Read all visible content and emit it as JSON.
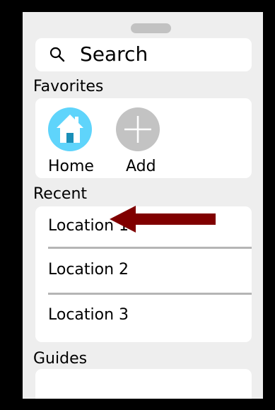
{
  "search": {
    "label": "Search",
    "icon": "search-icon"
  },
  "favorites": {
    "heading": "Favorites",
    "items": [
      {
        "label": "Home",
        "icon": "home-icon",
        "color": "#5fd4fb"
      },
      {
        "label": "Add",
        "icon": "plus-icon",
        "color": "#c3c3c3"
      }
    ]
  },
  "recent": {
    "heading": "Recent",
    "items": [
      {
        "label": "Location 1"
      },
      {
        "label": "Location 2"
      },
      {
        "label": "Location 3"
      }
    ]
  },
  "guides": {
    "heading": "Guides"
  },
  "annotation": {
    "icon": "arrow-left-icon",
    "color": "#800000"
  }
}
